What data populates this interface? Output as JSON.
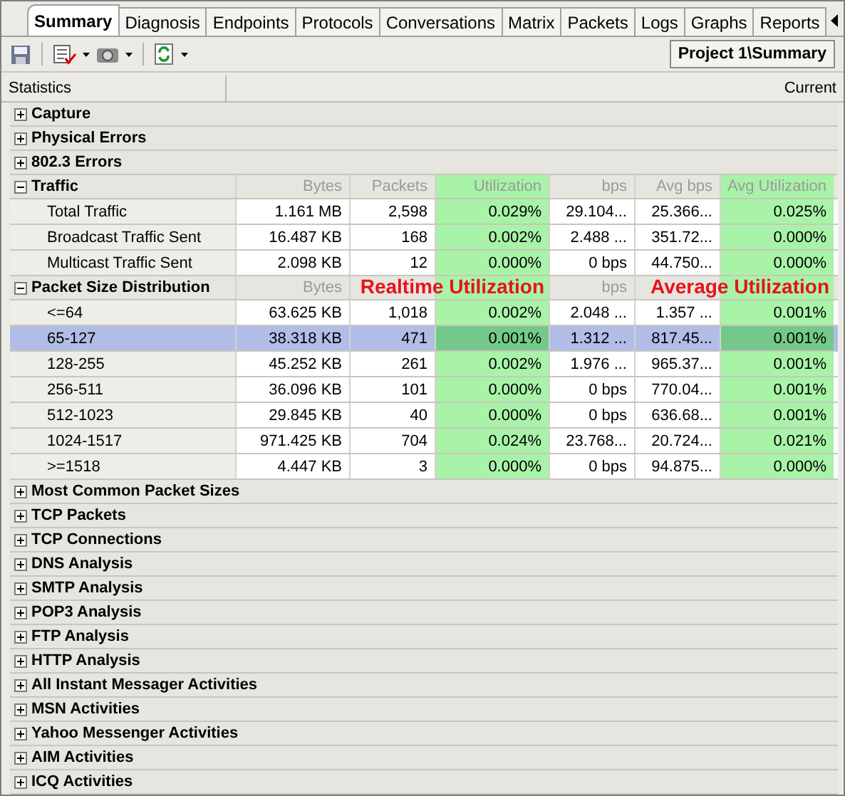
{
  "tabs": [
    {
      "label": "Summary",
      "selected": true
    },
    {
      "label": "Diagnosis",
      "selected": false
    },
    {
      "label": "Endpoints",
      "selected": false
    },
    {
      "label": "Protocols",
      "selected": false
    },
    {
      "label": "Conversations",
      "selected": false
    },
    {
      "label": "Matrix",
      "selected": false
    },
    {
      "label": "Packets",
      "selected": false
    },
    {
      "label": "Logs",
      "selected": false
    },
    {
      "label": "Graphs",
      "selected": false
    },
    {
      "label": "Reports",
      "selected": false
    }
  ],
  "breadcrumb": "Project 1\\Summary",
  "table_header": {
    "statistics": "Statistics",
    "current": "Current"
  },
  "groups": [
    {
      "label": "Capture",
      "expanded": false
    },
    {
      "label": "Physical Errors",
      "expanded": false
    },
    {
      "label": "802.3 Errors",
      "expanded": false
    },
    {
      "label": "Traffic",
      "expanded": true,
      "columns": [
        {
          "label": "Bytes",
          "kind": "value"
        },
        {
          "label": "Packets",
          "kind": "value"
        },
        {
          "label": "Utilization",
          "kind": "utilization"
        },
        {
          "label": "bps",
          "kind": "value"
        },
        {
          "label": "Avg bps",
          "kind": "value"
        },
        {
          "label": "Avg Utilization",
          "kind": "utilization"
        }
      ],
      "rows": [
        {
          "label": "Total Traffic",
          "selected": false,
          "cells": [
            "1.161 MB",
            "2,598",
            "0.029%",
            "29.104...",
            "25.366...",
            "0.025%"
          ]
        },
        {
          "label": "Broadcast Traffic Sent",
          "selected": false,
          "cells": [
            "16.487 KB",
            "168",
            "0.002%",
            "2.488 ...",
            "351.72...",
            "0.000%"
          ]
        },
        {
          "label": "Multicast Traffic Sent",
          "selected": false,
          "cells": [
            "2.098 KB",
            "12",
            "0.000%",
            "0 bps",
            "44.750...",
            "0.000%"
          ]
        }
      ]
    },
    {
      "label": "Packet Size Distribution",
      "expanded": true,
      "columns": [
        {
          "label": "Bytes",
          "kind": "value"
        },
        {
          "kind": "value"
        },
        {
          "kind": "utilization",
          "annotation": "Realtime Utilization"
        },
        {
          "label": "bps",
          "kind": "value"
        },
        {
          "kind": "value"
        },
        {
          "kind": "utilization",
          "annotation": "Average Utilization"
        }
      ],
      "rows": [
        {
          "label": "<=64",
          "selected": false,
          "cells": [
            "63.625 KB",
            "1,018",
            "0.002%",
            "2.048 ...",
            "1.357 ...",
            "0.001%"
          ]
        },
        {
          "label": "65-127",
          "selected": true,
          "cells": [
            "38.318 KB",
            "471",
            "0.001%",
            "1.312 ...",
            "817.45...",
            "0.001%"
          ]
        },
        {
          "label": "128-255",
          "selected": false,
          "cells": [
            "45.252 KB",
            "261",
            "0.002%",
            "1.976 ...",
            "965.37...",
            "0.001%"
          ]
        },
        {
          "label": "256-511",
          "selected": false,
          "cells": [
            "36.096 KB",
            "101",
            "0.000%",
            "0 bps",
            "770.04...",
            "0.001%"
          ]
        },
        {
          "label": "512-1023",
          "selected": false,
          "cells": [
            "29.845 KB",
            "40",
            "0.000%",
            "0 bps",
            "636.68...",
            "0.001%"
          ]
        },
        {
          "label": "1024-1517",
          "selected": false,
          "cells": [
            "971.425 KB",
            "704",
            "0.024%",
            "23.768...",
            "20.724...",
            "0.021%"
          ]
        },
        {
          "label": ">=1518",
          "selected": false,
          "cells": [
            "4.447 KB",
            "3",
            "0.000%",
            "0 bps",
            "94.875...",
            "0.000%"
          ]
        }
      ]
    },
    {
      "label": "Most Common Packet Sizes",
      "expanded": false
    },
    {
      "label": "TCP Packets",
      "expanded": false
    },
    {
      "label": "TCP Connections",
      "expanded": false
    },
    {
      "label": "DNS Analysis",
      "expanded": false
    },
    {
      "label": "SMTP Analysis",
      "expanded": false
    },
    {
      "label": "POP3 Analysis",
      "expanded": false
    },
    {
      "label": "FTP Analysis",
      "expanded": false
    },
    {
      "label": "HTTP Analysis",
      "expanded": false
    },
    {
      "label": "All Instant Messager Activities",
      "expanded": false
    },
    {
      "label": "MSN Activities",
      "expanded": false
    },
    {
      "label": "Yahoo Messenger Activities",
      "expanded": false
    },
    {
      "label": "AIM Activities",
      "expanded": false
    },
    {
      "label": "ICQ Activities",
      "expanded": false
    }
  ]
}
